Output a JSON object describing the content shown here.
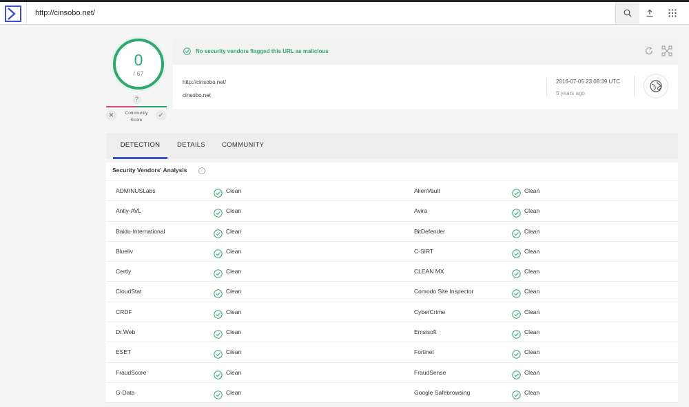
{
  "header": {
    "url_value": "http://cinsobo.net/",
    "icons": [
      "virustotal-logo",
      "search-icon",
      "upload-icon",
      "apps-grid-icon"
    ]
  },
  "score": {
    "detections": "0",
    "total": "/ 67",
    "community_question": "?",
    "community_label_1": "Community",
    "community_label_2": "Score",
    "vote_down": "✕",
    "vote_up": "✓"
  },
  "banner": {
    "message": "No security vendors flagged this URL as malicious",
    "color": "#2fa86e"
  },
  "info": {
    "url": "http://cinsobo.net/",
    "domain": "cinsobo.net",
    "date": "2016-07-05 23:08:39 UTC",
    "ago": "5 years ago"
  },
  "tabs": [
    "DETECTION",
    "DETAILS",
    "COMMUNITY"
  ],
  "section": {
    "title": "Security Vendors' Analysis",
    "info": "i"
  },
  "vendors": [
    {
      "a": "ADMINUSLabs",
      "a_res": "Clean",
      "b": "AlienVault",
      "b_res": "Clean"
    },
    {
      "a": "Antiy-AVL",
      "a_res": "Clean",
      "b": "Avira",
      "b_res": "Clean"
    },
    {
      "a": "Baidu-International",
      "a_res": "Clean",
      "b": "BitDefender",
      "b_res": "Clean"
    },
    {
      "a": "Blueliv",
      "a_res": "Clean",
      "b": "C-SIRT",
      "b_res": "Clean"
    },
    {
      "a": "Certly",
      "a_res": "Clean",
      "b": "CLEAN MX",
      "b_res": "Clean"
    },
    {
      "a": "CloudStat",
      "a_res": "Clean",
      "b": "Comodo Site Inspector",
      "b_res": "Clean"
    },
    {
      "a": "CRDF",
      "a_res": "Clean",
      "b": "CyberCrime",
      "b_res": "Clean"
    },
    {
      "a": "Dr.Web",
      "a_res": "Clean",
      "b": "Emsisoft",
      "b_res": "Clean"
    },
    {
      "a": "ESET",
      "a_res": "Clean",
      "b": "Fortinet",
      "b_res": "Clean"
    },
    {
      "a": "FraudScore",
      "a_res": "Clean",
      "b": "FraudSense",
      "b_res": "Clean"
    },
    {
      "a": "G-Data",
      "a_res": "Clean",
      "b": "Google Safebrowsing",
      "b_res": "Clean"
    }
  ]
}
